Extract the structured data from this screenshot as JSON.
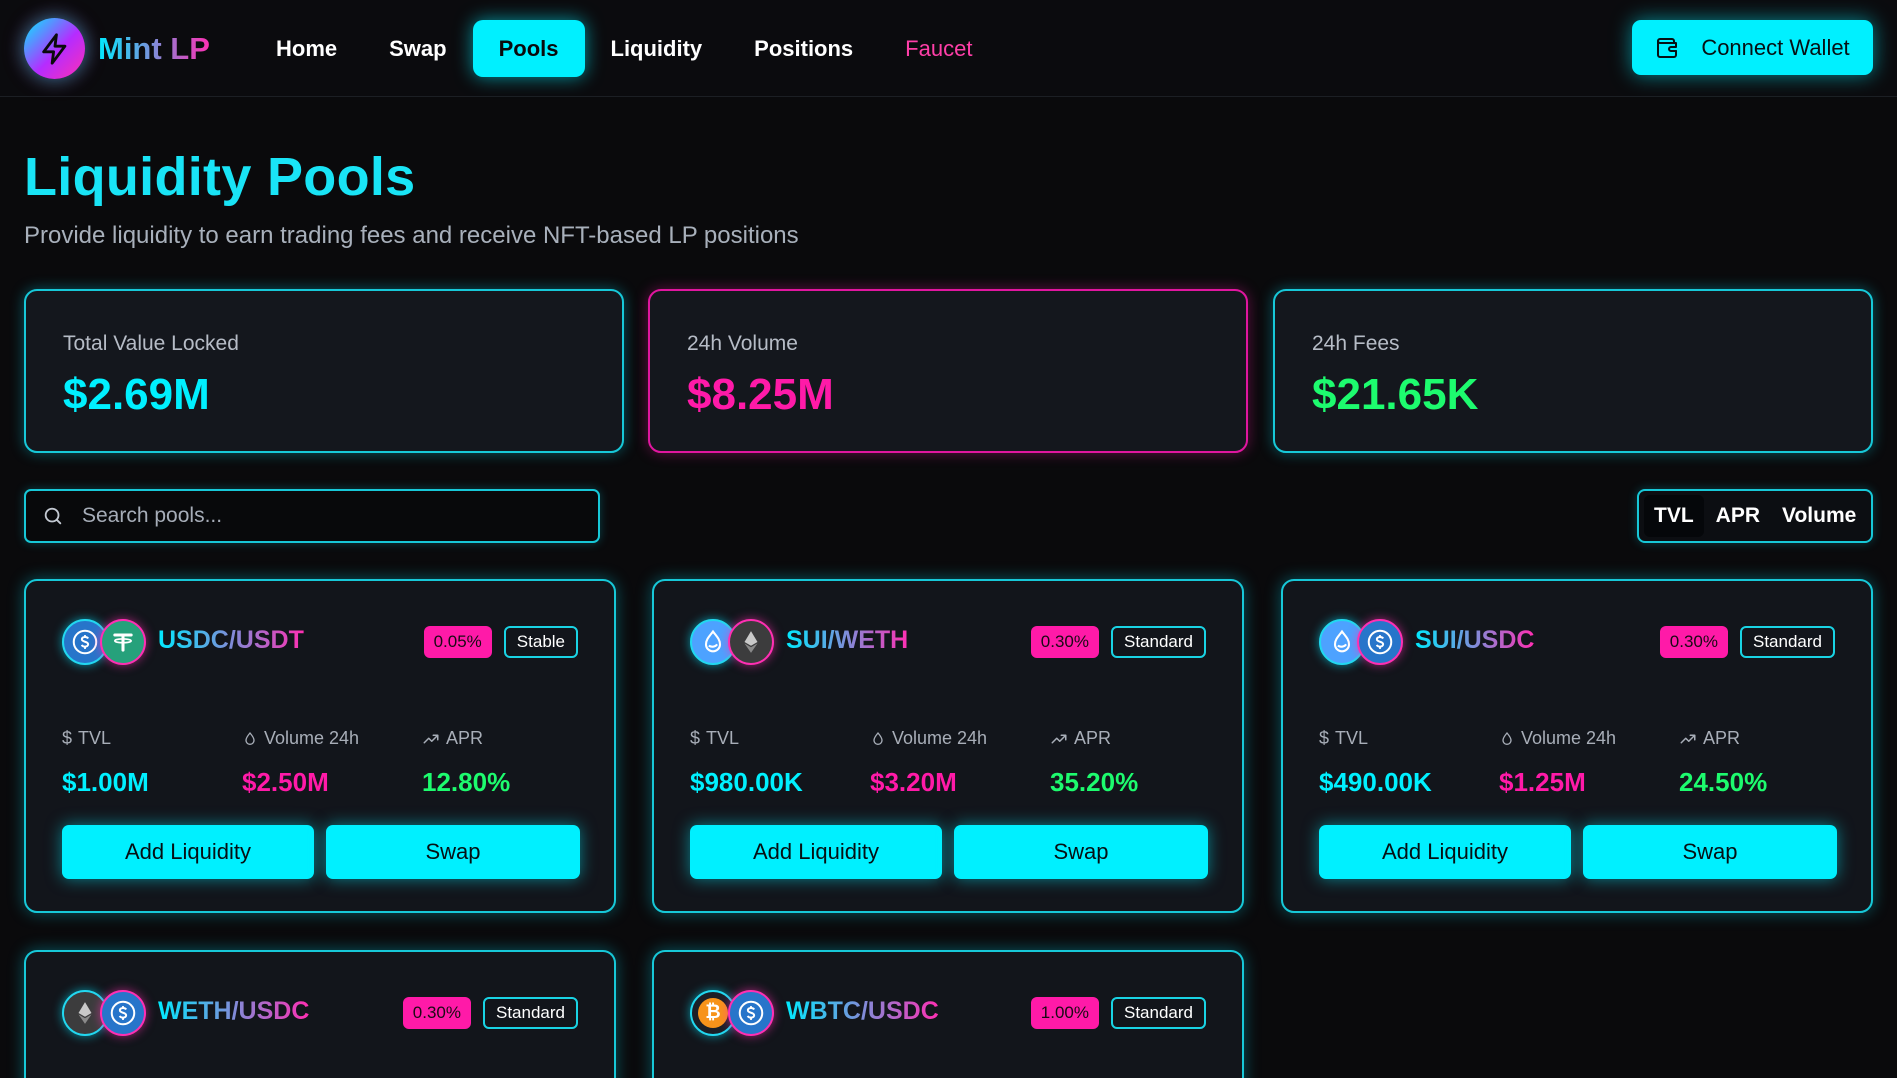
{
  "colors": {
    "accent_cyan": "#00f0ff",
    "accent_pink": "#ff1aa8",
    "accent_green": "#1dfb6e",
    "background": "#0a0a0c",
    "card": "#12151b"
  },
  "nav": {
    "logo_icon": "lightning-icon",
    "app_name": "Mint LP",
    "links": [
      "Home",
      "Swap",
      "Pools",
      "Liquidity",
      "Positions",
      "Faucet"
    ],
    "active": "Pools",
    "connect_icon": "wallet-icon",
    "connect_label": "Connect Wallet"
  },
  "header": {
    "title": "Liquidity Pools",
    "subtitle": "Provide liquidity to earn trading fees and receive NFT-based LP positions"
  },
  "stats": [
    {
      "label": "Total Value Locked",
      "value": "$2.69M",
      "color": "#00f0ff"
    },
    {
      "label": "24h Volume",
      "value": "$8.25M",
      "color": "#ff1aa8"
    },
    {
      "label": "24h Fees",
      "value": "$21.65K",
      "color": "#1dfb6e"
    }
  ],
  "search": {
    "icon": "search-icon",
    "placeholder": "Search pools...",
    "value": ""
  },
  "sort": {
    "options": [
      "TVL",
      "APR",
      "Volume"
    ],
    "active": "TVL"
  },
  "metric_labels": {
    "tvl": "TVL",
    "volume": "Volume 24h",
    "apr": "APR"
  },
  "pools": [
    {
      "name": "USDC/USDT",
      "fee": "0.05%",
      "type": "Stable",
      "token_icons": [
        "usdc-icon",
        "usdt-icon"
      ],
      "tvl": "$1.00M",
      "volume": "$2.50M",
      "apr": "12.80%",
      "add_label": "Add Liquidity",
      "swap_label": "Swap"
    },
    {
      "name": "SUI/WETH",
      "fee": "0.30%",
      "type": "Standard",
      "token_icons": [
        "sui-icon",
        "eth-icon"
      ],
      "tvl": "$980.00K",
      "volume": "$3.20M",
      "apr": "35.20%",
      "add_label": "Add Liquidity",
      "swap_label": "Swap"
    },
    {
      "name": "SUI/USDC",
      "fee": "0.30%",
      "type": "Standard",
      "token_icons": [
        "sui-icon",
        "usdc-icon"
      ],
      "tvl": "$490.00K",
      "volume": "$1.25M",
      "apr": "24.50%",
      "add_label": "Add Liquidity",
      "swap_label": "Swap"
    },
    {
      "name": "WETH/USDC",
      "fee": "0.30%",
      "type": "Standard",
      "token_icons": [
        "eth-icon",
        "usdc-icon"
      ]
    },
    {
      "name": "WBTC/USDC",
      "fee": "1.00%",
      "type": "Standard",
      "token_icons": [
        "btc-icon",
        "usdc-icon"
      ]
    }
  ]
}
